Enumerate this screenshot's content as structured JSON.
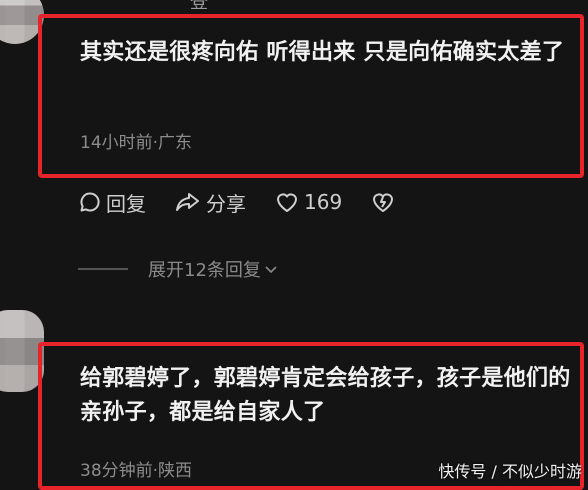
{
  "top_partial_text": "登",
  "comment1": {
    "text": "其实还是很疼向佑 听得出来 只是向佑确实太差了",
    "meta": "14小时前·广东",
    "actions": {
      "reply_label": "回复",
      "share_label": "分享",
      "like_count": "169"
    },
    "expand_label": "展开12条回复"
  },
  "comment2": {
    "text": "给郭碧婷了，郭碧婷肯定会给孩子，孩子是他们的亲孙子，都是给自家人了",
    "meta": "38分钟前·陕西"
  },
  "watermark": "快传号 / 不似少时游",
  "colors": {
    "highlight_border": "#e8242b",
    "background": "#151414"
  }
}
